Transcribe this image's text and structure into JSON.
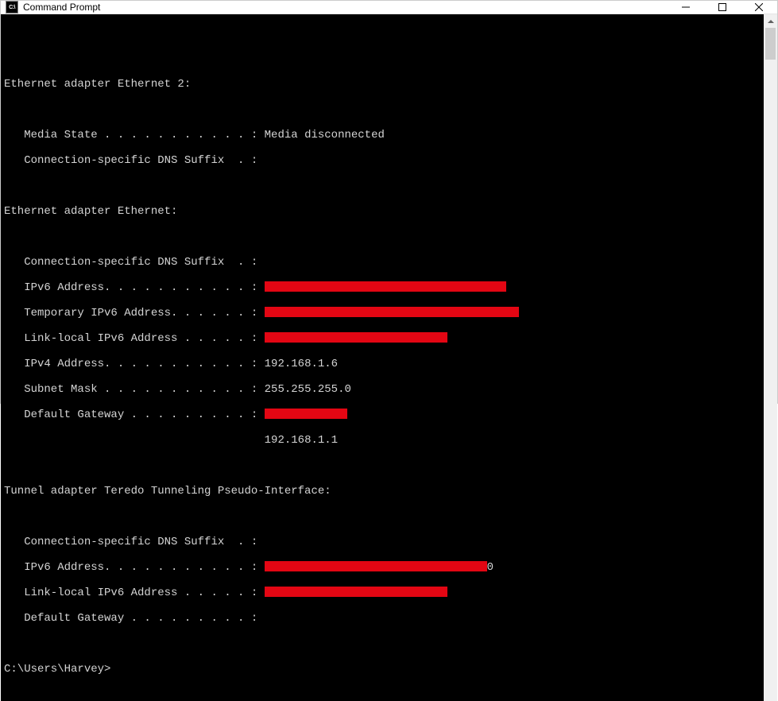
{
  "window": {
    "title": "Command Prompt",
    "icon_label": "C:\\"
  },
  "prompt": "C:\\Users\\Harvey>",
  "sections": {
    "eth2": {
      "header": "Ethernet adapter Ethernet 2:",
      "media_state_label": "   Media State . . . . . . . . . . . : ",
      "media_state_value": "Media disconnected",
      "dns_suffix_label": "   Connection-specific DNS Suffix  . :"
    },
    "eth": {
      "header": "Ethernet adapter Ethernet:",
      "dns_suffix_label": "   Connection-specific DNS Suffix  . :",
      "ipv6_label": "   IPv6 Address. . . . . . . . . . . : ",
      "temp_ipv6_label": "   Temporary IPv6 Address. . . . . . : ",
      "link_local_label": "   Link-local IPv6 Address . . . . . : ",
      "ipv4_label": "   IPv4 Address. . . . . . . . . . . : ",
      "ipv4_value": "192.168.1.6",
      "subnet_label": "   Subnet Mask . . . . . . . . . . . : ",
      "subnet_value": "255.255.255.0",
      "gateway_label": "   Default Gateway . . . . . . . . . : ",
      "gateway_indent": "                                       ",
      "gateway_value": "192.168.1.1"
    },
    "teredo": {
      "header": "Tunnel adapter Teredo Tunneling Pseudo-Interface:",
      "dns_suffix_label": "   Connection-specific DNS Suffix  . :",
      "ipv6_label": "   IPv6 Address. . . . . . . . . . . : ",
      "ipv6_trail": "0",
      "link_local_label": "   Link-local IPv6 Address . . . . . : ",
      "gateway_label": "   Default Gateway . . . . . . . . . :"
    }
  },
  "redact_widths": {
    "eth_ipv6": 304,
    "eth_temp_ipv6": 320,
    "eth_link_local": 230,
    "eth_gateway": 104,
    "teredo_ipv6": 280,
    "teredo_link_local": 230
  }
}
